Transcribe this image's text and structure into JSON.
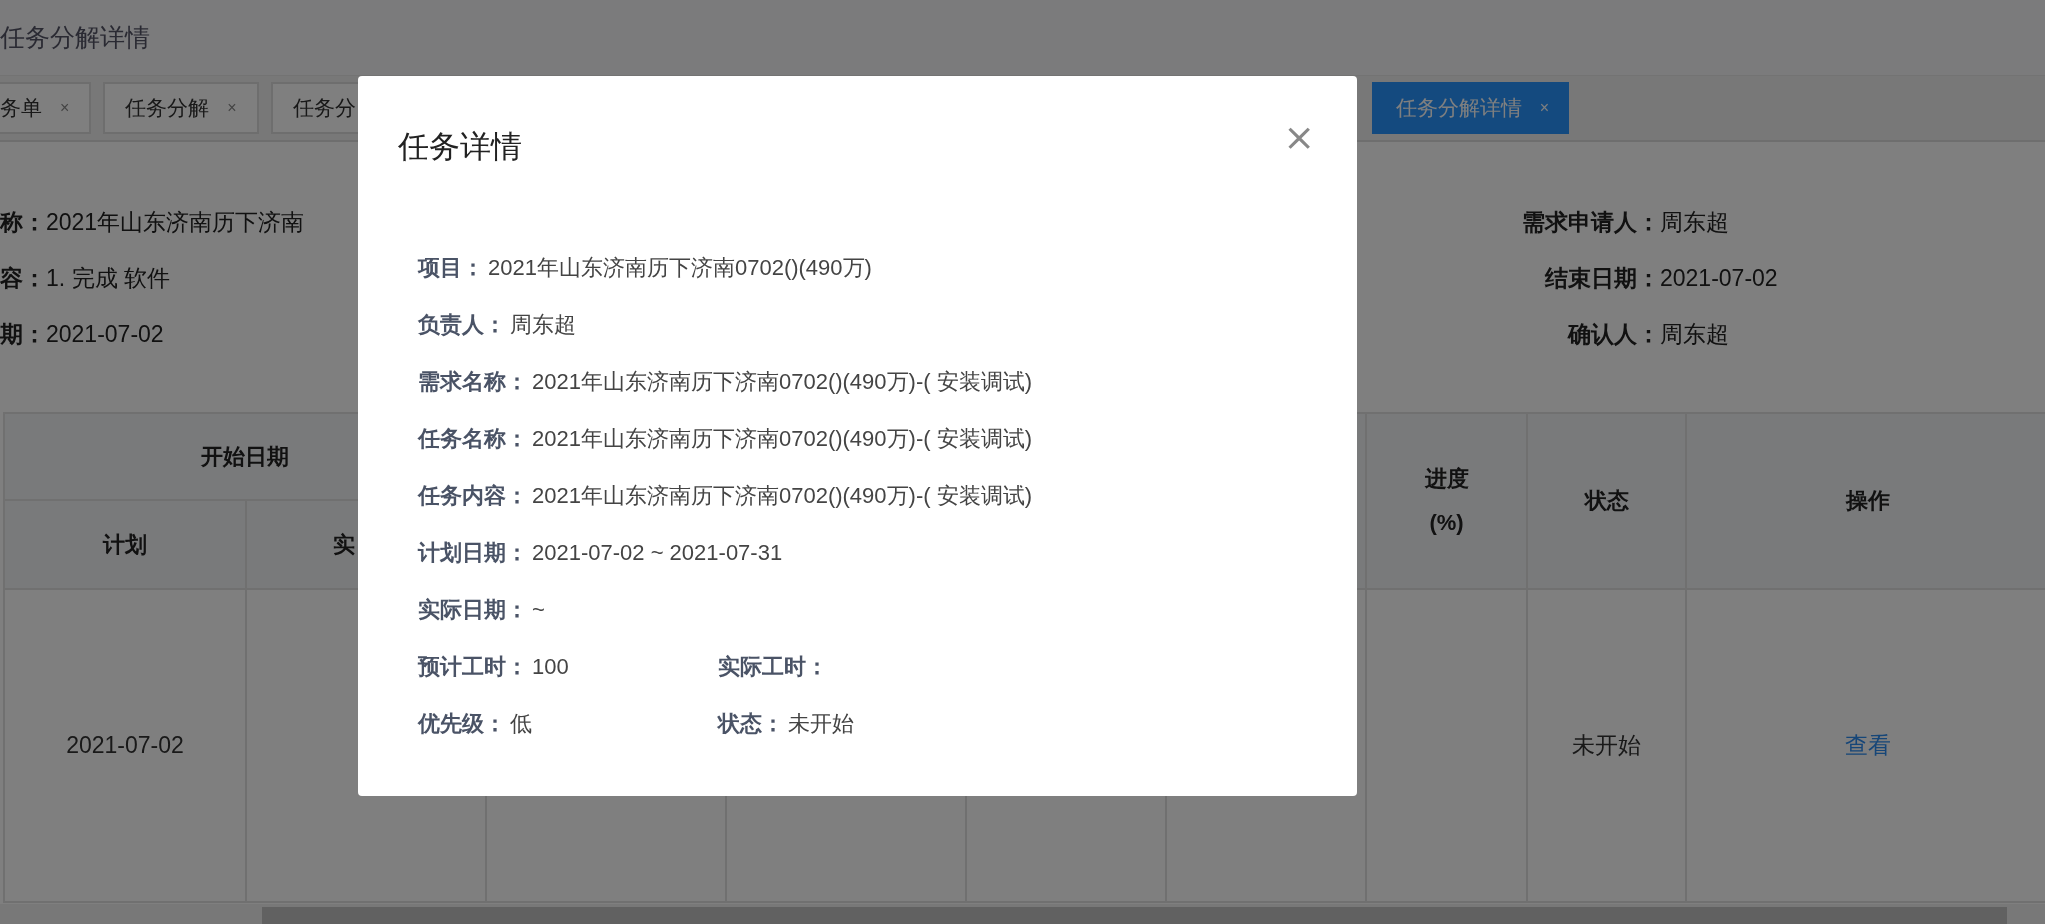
{
  "page_title": "任务分解详情",
  "tabs": [
    {
      "label": "务单",
      "close": "×",
      "selected": false
    },
    {
      "label": "任务分解",
      "close": "×",
      "selected": false
    },
    {
      "label": "任务分",
      "selected": false
    },
    {
      "label": "任务分解详情",
      "close": "×",
      "selected": true
    }
  ],
  "info_left": [
    {
      "label": "称：",
      "value": "2021年山东济南历下济南"
    },
    {
      "label": "容：",
      "value": "1. 完成 软件"
    },
    {
      "label": "期：",
      "value": "2021-07-02"
    }
  ],
  "info_right": [
    {
      "label": "需求申请人：",
      "value": "周东超"
    },
    {
      "label": "结束日期：",
      "value": "2021-07-02"
    },
    {
      "label": "确认人：",
      "value": "周东超"
    }
  ],
  "table": {
    "group_header": "开始日期",
    "sub_headers": [
      "计划",
      "实"
    ],
    "columns": [
      "进度\n(%)",
      "状态",
      "操作"
    ],
    "rows": [
      {
        "plan_date": "2021-07-02",
        "status": "未开始",
        "action": "查看"
      }
    ]
  },
  "modal": {
    "title": "任务详情",
    "close": "×",
    "rows": [
      [
        {
          "label": "项目：",
          "value": "2021年山东济南历下济南0702()(490万)"
        }
      ],
      [
        {
          "label": "负责人：",
          "value": "周东超"
        }
      ],
      [
        {
          "label": "需求名称：",
          "value": "2021年山东济南历下济南0702()(490万)-( 安装调试)"
        }
      ],
      [
        {
          "label": "任务名称：",
          "value": "2021年山东济南历下济南0702()(490万)-( 安装调试)"
        }
      ],
      [
        {
          "label": "任务内容：",
          "value": "2021年山东济南历下济南0702()(490万)-( 安装调试)"
        }
      ],
      [
        {
          "label": "计划日期：",
          "value": "2021-07-02 ~ 2021-07-31"
        }
      ],
      [
        {
          "label": "实际日期：",
          "value": "~"
        }
      ],
      [
        {
          "label": "预计工时：",
          "value": "100"
        },
        {
          "label": "实际工时："
        }
      ],
      [
        {
          "label": "优先级：",
          "value": "低"
        },
        {
          "label": "状态：",
          "value": "未开始"
        }
      ]
    ]
  }
}
